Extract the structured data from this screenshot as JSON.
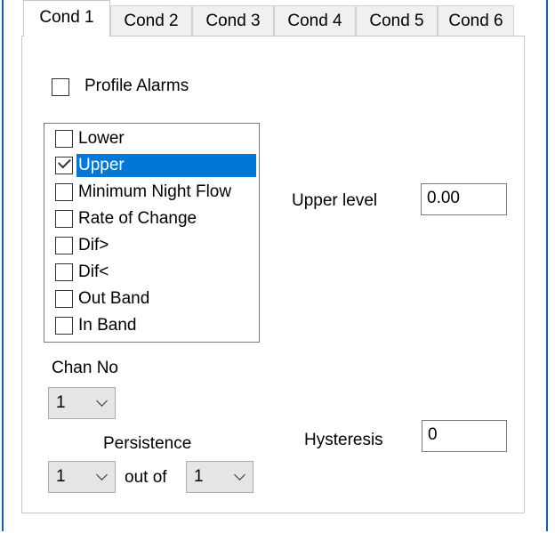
{
  "tabs": [
    {
      "label": "Cond 1",
      "active": true
    },
    {
      "label": "Cond 2",
      "active": false
    },
    {
      "label": "Cond 3",
      "active": false
    },
    {
      "label": "Cond 4",
      "active": false
    },
    {
      "label": "Cond 5",
      "active": false
    },
    {
      "label": "Cond 6",
      "active": false
    }
  ],
  "profile_alarms": {
    "label": "Profile Alarms",
    "checked": false
  },
  "alarm_types": [
    {
      "label": "Lower",
      "checked": false,
      "selected": false
    },
    {
      "label": "Upper",
      "checked": true,
      "selected": true
    },
    {
      "label": "Minimum Night Flow",
      "checked": false,
      "selected": false
    },
    {
      "label": "Rate of Change",
      "checked": false,
      "selected": false
    },
    {
      "label": "Dif>",
      "checked": false,
      "selected": false
    },
    {
      "label": "Dif<",
      "checked": false,
      "selected": false
    },
    {
      "label": "Out Band",
      "checked": false,
      "selected": false
    },
    {
      "label": "In Band",
      "checked": false,
      "selected": false
    }
  ],
  "upper_level": {
    "label": "Upper level",
    "value": "0.00"
  },
  "chan_no": {
    "label": "Chan No",
    "value": "1"
  },
  "hysteresis": {
    "label": "Hysteresis",
    "value": "0"
  },
  "persistence": {
    "label": "Persistence",
    "value": "1",
    "out_of_label": "out of",
    "out_of_value": "1"
  },
  "colors": {
    "selection": "#0078d7",
    "window_border": "#0e5fb5"
  }
}
